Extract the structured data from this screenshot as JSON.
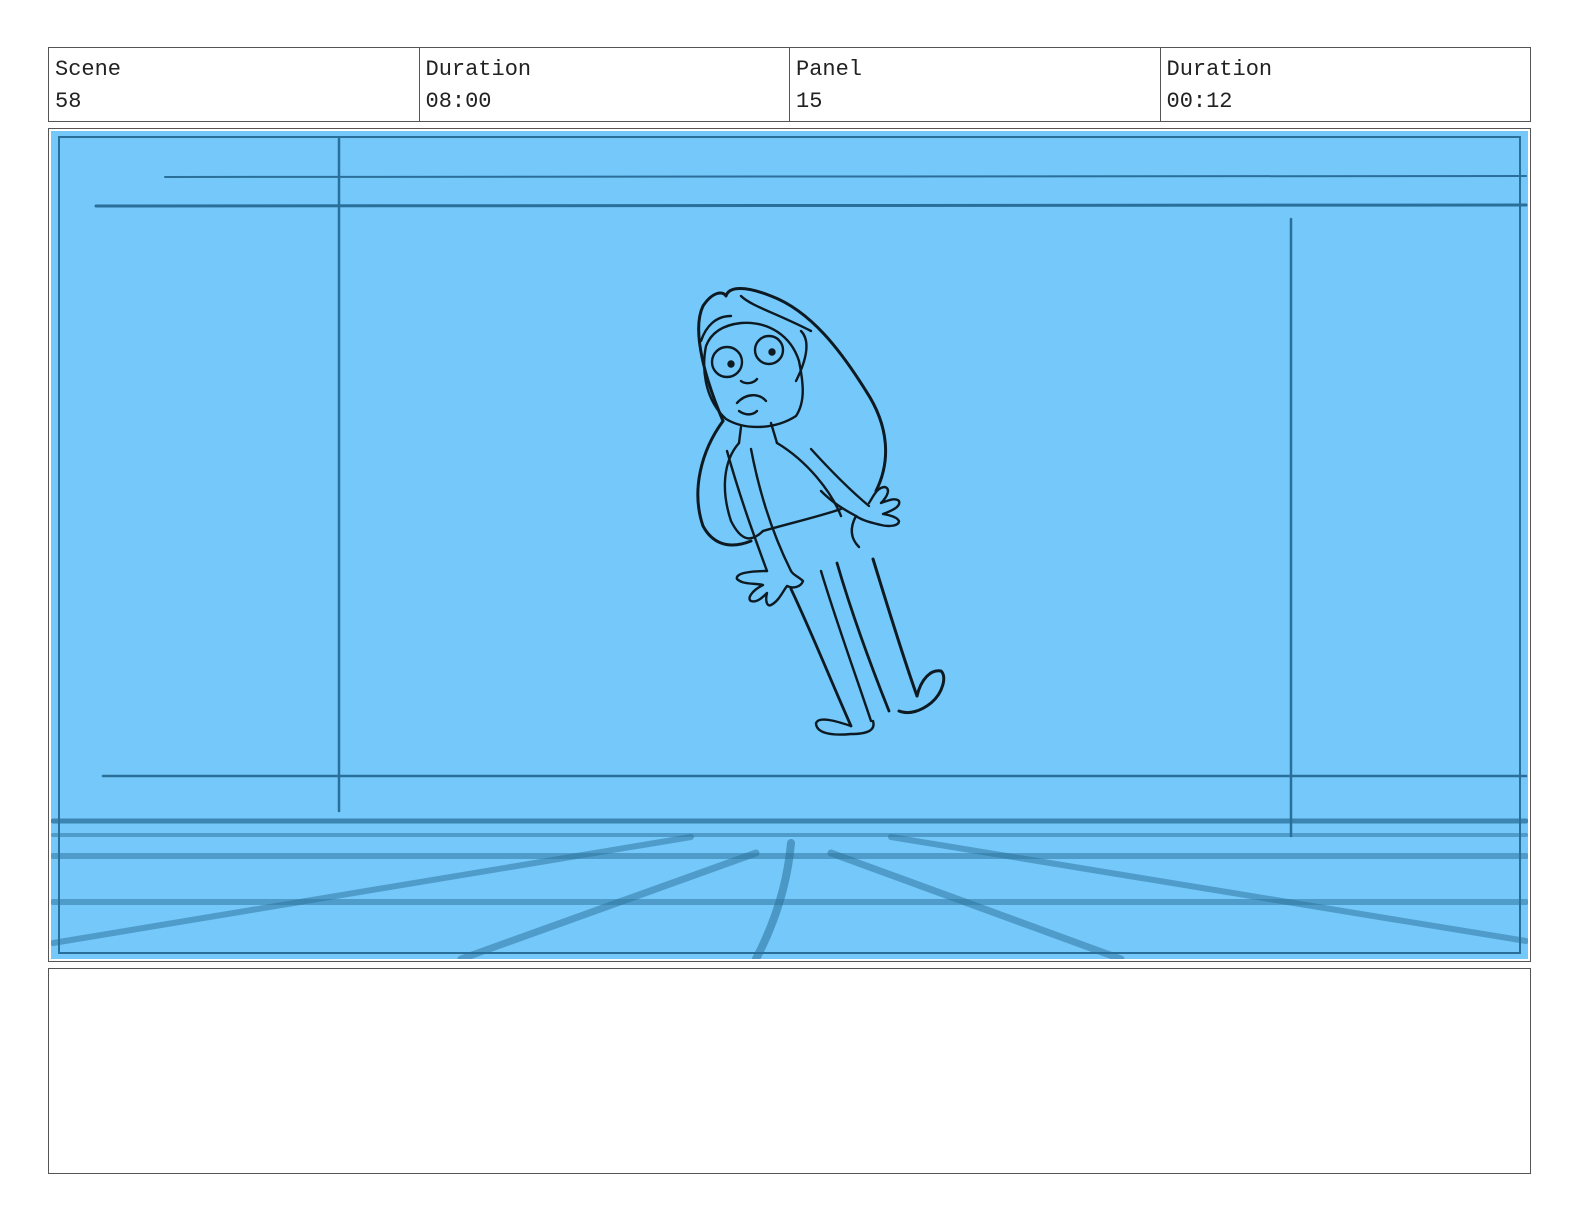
{
  "header": {
    "scene_label": "Scene",
    "scene_value": "58",
    "scene_duration_label": "Duration",
    "scene_duration_value": "08:00",
    "panel_label": "Panel",
    "panel_value": "15",
    "panel_duration_label": "Duration",
    "panel_duration_value": "00:12"
  },
  "colors": {
    "panel_background": "#74c8fa",
    "layout_line": "#2a6f99",
    "sketch_line": "#0d1a22"
  },
  "notes": {
    "text": ""
  }
}
